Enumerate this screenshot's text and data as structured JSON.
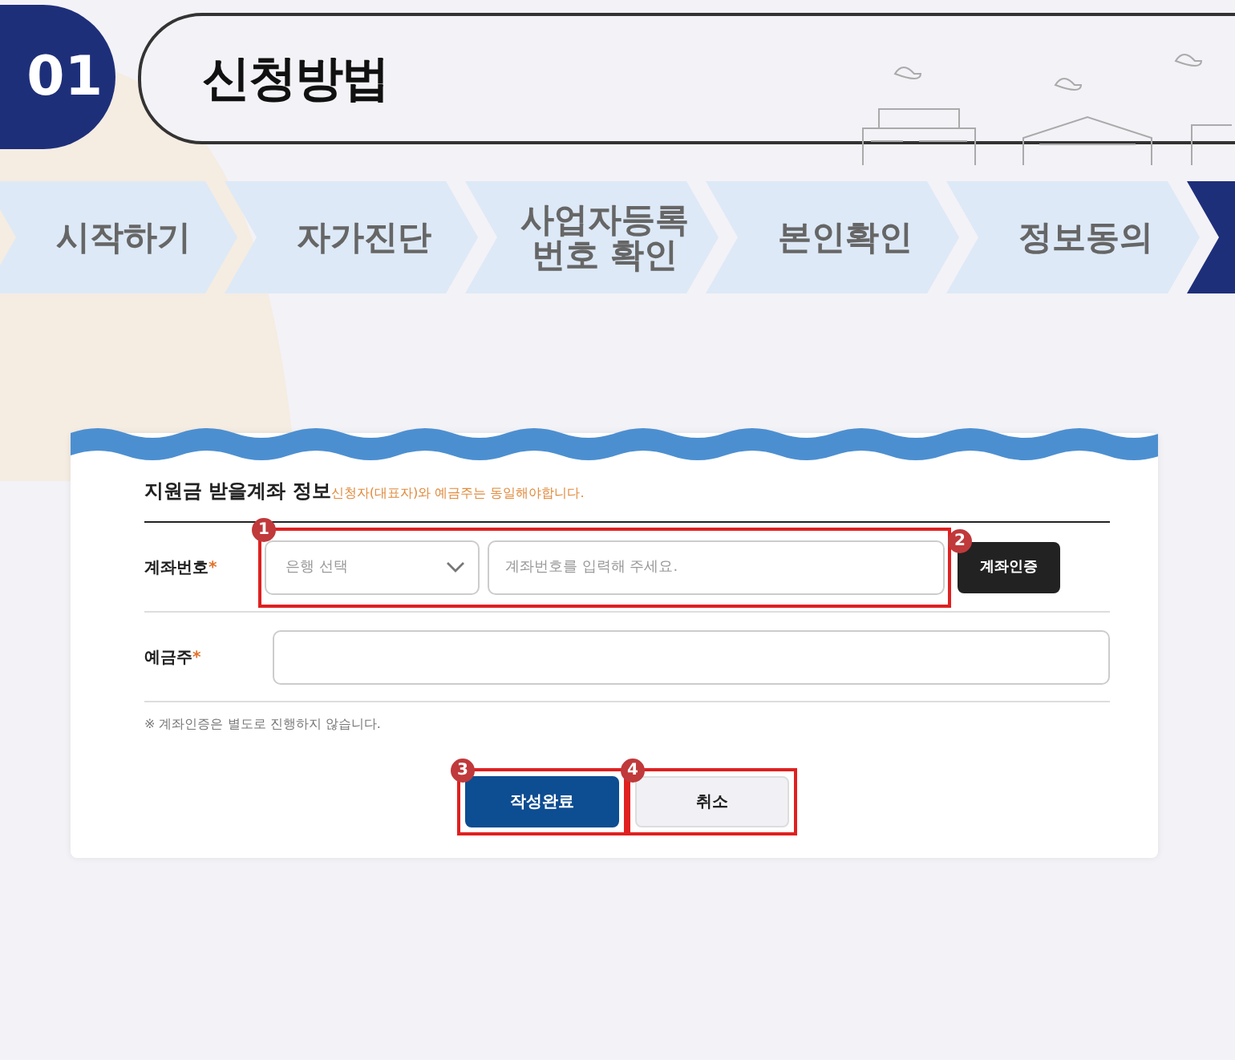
{
  "header": {
    "number": "01",
    "title": "신청방법"
  },
  "steps": [
    {
      "label": "시작하기",
      "selected": false
    },
    {
      "label": "자가진단",
      "selected": false
    },
    {
      "label": "사업자등록\n번호 확인",
      "selected": false
    },
    {
      "label": "본인확인",
      "selected": false
    },
    {
      "label": "정보동의",
      "selected": false
    },
    {
      "selected": true
    }
  ],
  "form": {
    "title": "지원금 받을계좌 정보",
    "title_note": "신청자(대표자)와 예금주는 동일해야합니다.",
    "account": {
      "label": "계좌번호",
      "required_mark": "*",
      "bank_select": {
        "placeholder": "은행 선택"
      },
      "number_field": {
        "placeholder": "계좌번호를 입력해 주세요."
      },
      "callout": "1",
      "verify_button": {
        "label": "계좌인증",
        "callout": "2"
      }
    },
    "holder": {
      "label": "예금주",
      "required_mark": "*"
    },
    "note": "※ 계좌인증은 별도로 진행하지 않습니다.",
    "buttons": [
      {
        "label": "작성완료",
        "kind": "primary",
        "callout": "3"
      },
      {
        "label": "취소",
        "kind": "secondary",
        "callout": "4"
      }
    ]
  }
}
